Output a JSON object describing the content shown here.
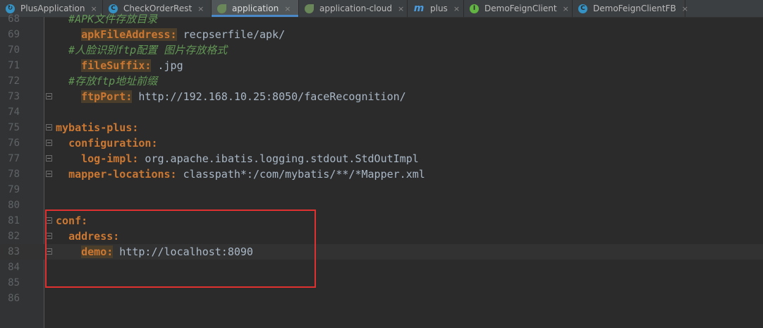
{
  "tabs": [
    {
      "label": "PlusApplication",
      "icon": "spring-app-icon",
      "active": false
    },
    {
      "label": "CheckOrderRest",
      "icon": "class-icon",
      "active": false
    },
    {
      "label": "application",
      "icon": "yaml-spring-icon",
      "active": true
    },
    {
      "label": "application-cloud",
      "icon": "yaml-spring-icon",
      "active": false
    },
    {
      "label": "plus",
      "icon": "mybatis-m-icon",
      "active": false
    },
    {
      "label": "DemoFeignClient",
      "icon": "interface-icon",
      "active": false
    },
    {
      "label": "DemoFeignClientFB",
      "icon": "class-icon",
      "active": false
    }
  ],
  "close_glyph": "×",
  "lines": [
    {
      "n": "68",
      "parts": [
        {
          "t": "  #APK文件存放目录",
          "c": "cmt"
        }
      ]
    },
    {
      "n": "69",
      "parts": [
        {
          "t": "    ",
          "c": "val"
        },
        {
          "t": "apkFileAddress:",
          "c": "key hl"
        },
        {
          "t": " recpserfile/apk/",
          "c": "val"
        }
      ]
    },
    {
      "n": "70",
      "parts": [
        {
          "t": "  #人脸识别ftp配置 图片存放格式",
          "c": "cmt"
        }
      ]
    },
    {
      "n": "71",
      "parts": [
        {
          "t": "    ",
          "c": "val"
        },
        {
          "t": "fileSuffix:",
          "c": "key hl"
        },
        {
          "t": " .jpg",
          "c": "val"
        }
      ]
    },
    {
      "n": "72",
      "parts": [
        {
          "t": "  #存放ftp地址前缀",
          "c": "cmt"
        }
      ]
    },
    {
      "n": "73",
      "parts": [
        {
          "t": "    ",
          "c": "val"
        },
        {
          "t": "ftpPort:",
          "c": "key hl"
        },
        {
          "t": " http://192.168.10.25:8050/faceRecognition/",
          "c": "val"
        }
      ]
    },
    {
      "n": "74",
      "parts": []
    },
    {
      "n": "75",
      "parts": [
        {
          "t": "mybatis-plus:",
          "c": "key"
        }
      ]
    },
    {
      "n": "76",
      "parts": [
        {
          "t": "  ",
          "c": "val"
        },
        {
          "t": "configuration:",
          "c": "key"
        }
      ]
    },
    {
      "n": "77",
      "parts": [
        {
          "t": "    ",
          "c": "val"
        },
        {
          "t": "log-impl:",
          "c": "key"
        },
        {
          "t": " org.apache.ibatis.logging.stdout.StdOutImpl",
          "c": "val"
        }
      ]
    },
    {
      "n": "78",
      "parts": [
        {
          "t": "  ",
          "c": "val"
        },
        {
          "t": "mapper-locations:",
          "c": "key"
        },
        {
          "t": " classpath*:/com/mybatis/**/*Mapper.xml",
          "c": "val"
        }
      ]
    },
    {
      "n": "79",
      "parts": []
    },
    {
      "n": "80",
      "parts": []
    },
    {
      "n": "81",
      "parts": [
        {
          "t": "conf:",
          "c": "key"
        }
      ]
    },
    {
      "n": "82",
      "parts": [
        {
          "t": "  ",
          "c": "val"
        },
        {
          "t": "address:",
          "c": "key"
        }
      ]
    },
    {
      "n": "83",
      "parts": [
        {
          "t": "    ",
          "c": "val"
        },
        {
          "t": "demo:",
          "c": "key hl"
        },
        {
          "t": " http://localhost:8090",
          "c": "val"
        }
      ]
    },
    {
      "n": "84",
      "parts": []
    },
    {
      "n": "85",
      "parts": []
    },
    {
      "n": "86",
      "parts": []
    }
  ],
  "current_line": "83",
  "colors": {
    "accent": "#4a88c7",
    "highlight_box": "#e03131",
    "key": "#cc7832",
    "comment": "#629755"
  }
}
